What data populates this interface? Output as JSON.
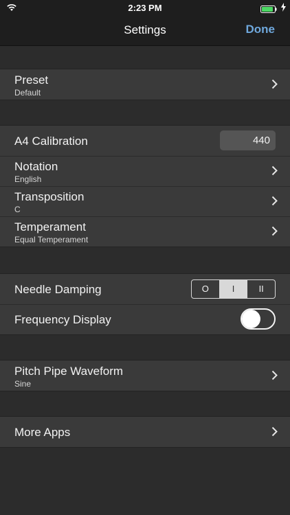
{
  "status": {
    "time": "2:23 PM"
  },
  "nav": {
    "title": "Settings",
    "done": "Done"
  },
  "preset": {
    "title": "Preset",
    "value": "Default"
  },
  "a4": {
    "title": "A4 Calibration",
    "value": "440"
  },
  "notation": {
    "title": "Notation",
    "value": "English"
  },
  "transposition": {
    "title": "Transposition",
    "value": "C"
  },
  "temperament": {
    "title": "Temperament",
    "value": "Equal Temperament"
  },
  "needle": {
    "title": "Needle Damping",
    "options": [
      "O",
      "I",
      "II"
    ],
    "selected": "I"
  },
  "frequency": {
    "title": "Frequency Display",
    "enabled": false
  },
  "pitch": {
    "title": "Pitch Pipe Waveform",
    "value": "Sine"
  },
  "more": {
    "title": "More Apps"
  },
  "colors": {
    "accent": "#6fa8dc",
    "background": "#2c2c2c",
    "cell": "#3a3a3a"
  }
}
